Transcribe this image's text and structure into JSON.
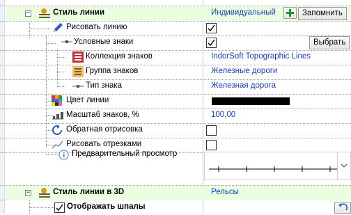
{
  "rows": [
    {
      "name": "Стиль линии",
      "value": "Индивидуальный",
      "button": "Запомнить"
    },
    {
      "name": "Рисовать линию",
      "checked": true
    },
    {
      "name": "Условные знаки",
      "checked": true,
      "button": "Выбрать"
    },
    {
      "name": "Коллекция знаков",
      "value": "IndorSoft Topographic Lines"
    },
    {
      "name": "Группа знаков",
      "value": "Железные дороги"
    },
    {
      "name": "Тип знака",
      "value": "Железная дорога"
    },
    {
      "name": "Цвет линии",
      "color": "#000000"
    },
    {
      "name": "Масштаб знаков, %",
      "value": "100,00"
    },
    {
      "name": "Обратная отрисовка",
      "checked": false
    },
    {
      "name": "Рисовать отрезками",
      "checked": false
    },
    {
      "name": "Предварительный просмотр"
    },
    {
      "name": "Стиль линии в 3D",
      "value": "Рельсы"
    },
    {
      "name": "Отображать шпалы",
      "checked": true
    }
  ],
  "colors": {
    "header_bg": "#eaffdf",
    "link": "#1a3ccc"
  }
}
